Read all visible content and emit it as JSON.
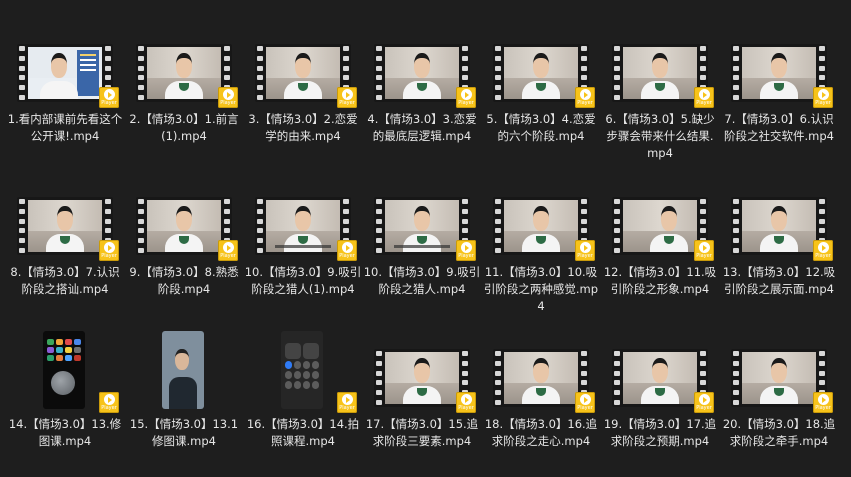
{
  "badge_label": "Player",
  "files": [
    {
      "name": "1.看内部课前先看这个公开课!.mp4",
      "thumb": "screen"
    },
    {
      "name": "2.【情场3.0】1.前言 (1).mp4",
      "thumb": "video"
    },
    {
      "name": "3.【情场3.0】2.恋爱学的由来.mp4",
      "thumb": "video"
    },
    {
      "name": "4.【情场3.0】3.恋爱的最底层逻辑.mp4",
      "thumb": "video"
    },
    {
      "name": "5.【情场3.0】4.恋爱的六个阶段.mp4",
      "thumb": "video"
    },
    {
      "name": "6.【情场3.0】5.缺少步骤会带来什么结果.mp4",
      "thumb": "video"
    },
    {
      "name": "7.【情场3.0】6.认识阶段之社交软件.mp4",
      "thumb": "video"
    },
    {
      "name": "8.【情场3.0】7.认识阶段之搭讪.mp4",
      "thumb": "video"
    },
    {
      "name": "9.【情场3.0】8.熟悉阶段.mp4",
      "thumb": "video"
    },
    {
      "name": "10.【情场3.0】9.吸引阶段之猎人(1).mp4",
      "thumb": "video"
    },
    {
      "name": "10.【情场3.0】9.吸引阶段之猎人.mp4",
      "thumb": "video"
    },
    {
      "name": "11.【情场3.0】10.吸引阶段之两种感觉.mp4",
      "thumb": "video"
    },
    {
      "name": "12.【情场3.0】11.吸引阶段之形象.mp4",
      "thumb": "video"
    },
    {
      "name": "13.【情场3.0】12.吸引阶段之展示面.mp4",
      "thumb": "video"
    },
    {
      "name": "14.【情场3.0】13.修图课.mp4",
      "thumb": "phone-home"
    },
    {
      "name": "15.【情场3.0】13.1修图课.mp4",
      "thumb": "phone-photo"
    },
    {
      "name": "16.【情场3.0】14.拍照课程.mp4",
      "thumb": "phone-cc"
    },
    {
      "name": "17.【情场3.0】15.追求阶段三要素.mp4",
      "thumb": "video"
    },
    {
      "name": "18.【情场3.0】16.追求阶段之走心.mp4",
      "thumb": "video"
    },
    {
      "name": "19.【情场3.0】17.追求阶段之预期.mp4",
      "thumb": "video"
    },
    {
      "name": "20.【情场3.0】18.追求阶段之牵手.mp4",
      "thumb": "video"
    }
  ]
}
